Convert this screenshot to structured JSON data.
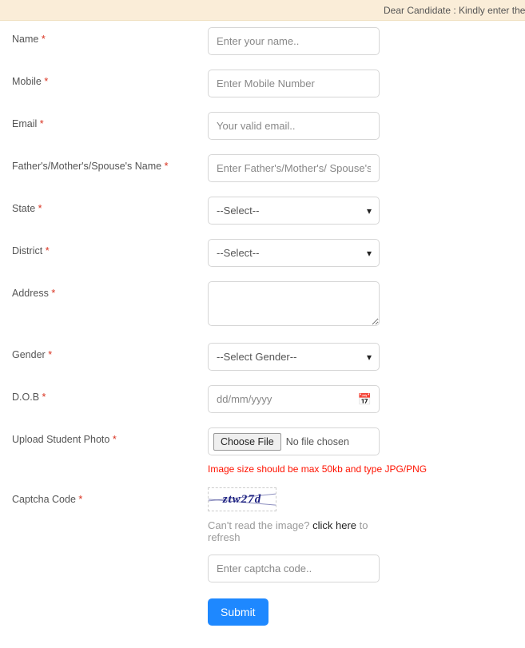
{
  "banner": {
    "text": "Dear Candidate : Kindly enter the details carefu"
  },
  "fields": {
    "name": {
      "label": "Name",
      "placeholder": "Enter your name.."
    },
    "mobile": {
      "label": "Mobile",
      "placeholder": "Enter Mobile Number"
    },
    "email": {
      "label": "Email",
      "placeholder": "Your valid email.."
    },
    "parent": {
      "label": "Father's/Mother's/Spouse's Name",
      "placeholder": "Enter Father's/Mother's/ Spouse's Name"
    },
    "state": {
      "label": "State",
      "selected": "--Select--"
    },
    "district": {
      "label": "District",
      "selected": "--Select--"
    },
    "address": {
      "label": "Address"
    },
    "gender": {
      "label": "Gender",
      "selected": "--Select Gender--"
    },
    "dob": {
      "label": "D.O.B",
      "placeholder": "dd/mm/yyyy"
    },
    "photo": {
      "label": "Upload Student Photo",
      "button": "Choose File",
      "status": "No file chosen",
      "hint": "Image size should be max 50kb and type JPG/PNG"
    },
    "captcha": {
      "label": "Captcha Code",
      "image_text": "ztw27d",
      "hint_prefix": "Can't read the image? ",
      "hint_link": "click here",
      "hint_suffix": " to refresh",
      "placeholder": "Enter captcha code.."
    }
  },
  "submit": {
    "label": "Submit"
  }
}
